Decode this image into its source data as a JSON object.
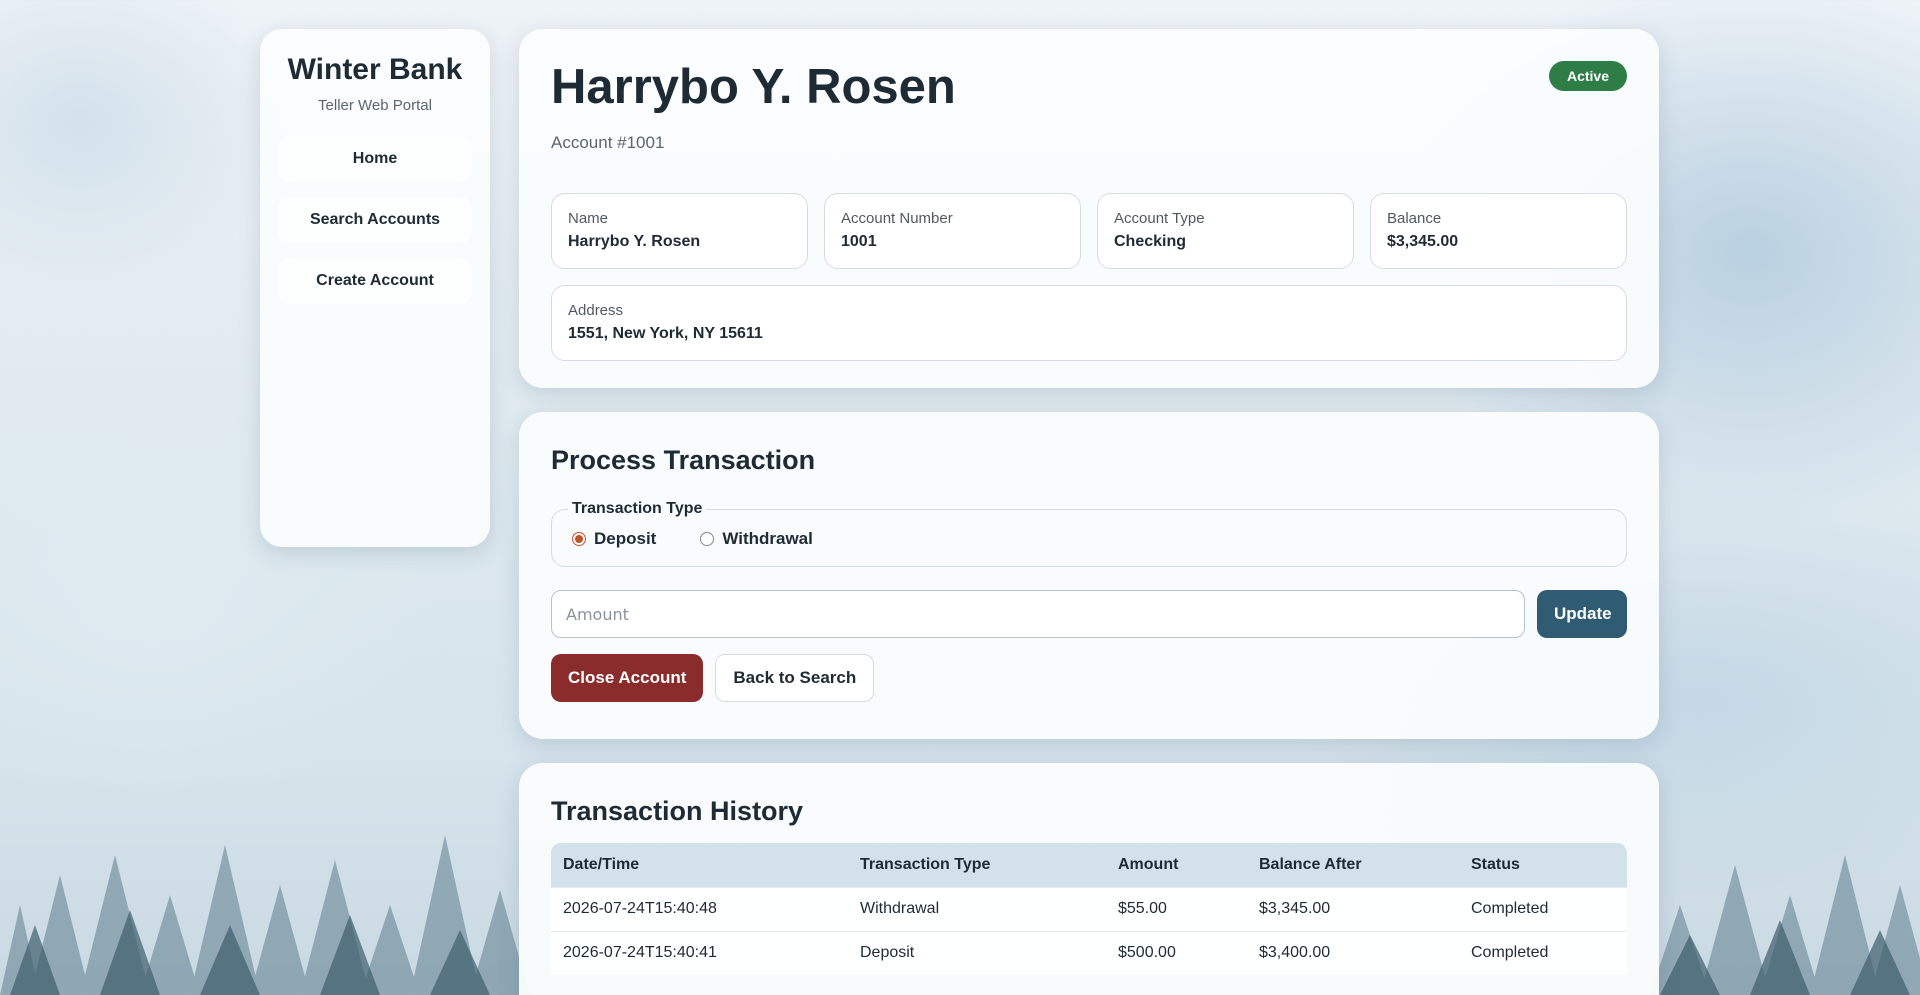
{
  "sidebar": {
    "brand": "Winter Bank",
    "subtitle": "Teller Web Portal",
    "nav": [
      {
        "label": "Home"
      },
      {
        "label": "Search Accounts"
      },
      {
        "label": "Create Account"
      }
    ]
  },
  "account": {
    "name": "Harrybo Y. Rosen",
    "number_line": "Account #1001",
    "status": "Active",
    "fields": [
      {
        "label": "Name",
        "value": "Harrybo Y. Rosen"
      },
      {
        "label": "Account Number",
        "value": "1001"
      },
      {
        "label": "Account Type",
        "value": "Checking"
      },
      {
        "label": "Balance",
        "value": "$3,345.00"
      }
    ],
    "address": {
      "label": "Address",
      "value": "1551, New York, NY 15611"
    }
  },
  "transaction": {
    "title": "Process Transaction",
    "type_legend": "Transaction Type",
    "options": [
      {
        "label": "Deposit",
        "checked": true
      },
      {
        "label": "Withdrawal",
        "checked": false
      }
    ],
    "amount_placeholder": "Amount",
    "update_label": "Update",
    "close_label": "Close Account",
    "back_label": "Back to Search"
  },
  "history": {
    "title": "Transaction History",
    "columns": [
      "Date/Time",
      "Transaction Type",
      "Amount",
      "Balance After",
      "Status"
    ],
    "rows": [
      [
        "2026-07-24T15:40:48",
        "Withdrawal",
        "$55.00",
        "$3,345.00",
        "Completed"
      ],
      [
        "2026-07-24T15:40:41",
        "Deposit",
        "$500.00",
        "$3,400.00",
        "Completed"
      ]
    ]
  },
  "colors": {
    "status_active": "#2e7d47",
    "update_button": "#2f5c72",
    "close_button": "#8a2c2c",
    "radio_accent": "#c0532a"
  }
}
